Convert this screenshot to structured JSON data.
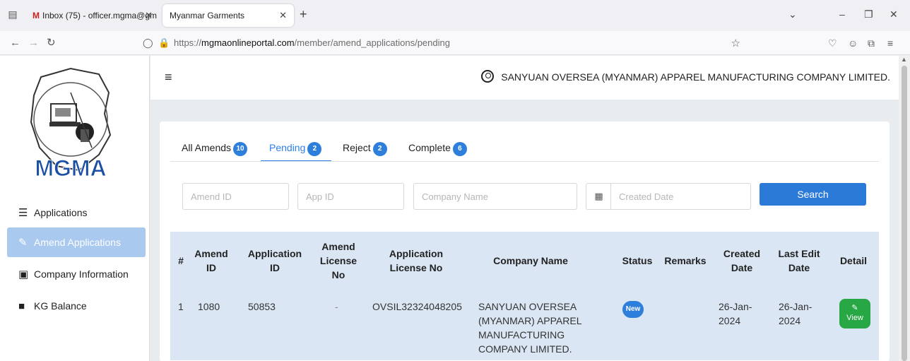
{
  "browser": {
    "tabs": [
      {
        "title": "Inbox (75) - officer.mgma@gm",
        "favicon": "M"
      },
      {
        "title": "Myanmar Garments"
      }
    ],
    "url_prefix": "https://",
    "url_domain": "mgmaonlineportal.com",
    "url_path": "/member/amend_applications/pending"
  },
  "sidebar": {
    "logo_text": "MGMA",
    "items": [
      {
        "label": "Applications",
        "icon": "list-icon"
      },
      {
        "label": "Amend Applications",
        "icon": "pencil-icon",
        "active": true
      },
      {
        "label": "Company Information",
        "icon": "copy-icon"
      },
      {
        "label": "KG Balance",
        "icon": "user-box-icon"
      }
    ]
  },
  "header": {
    "company": "SANYUAN OVERSEA (MYANMAR) APPAREL MANUFACTURING COMPANY LIMITED."
  },
  "tabs": [
    {
      "label": "All Amends",
      "count": "10"
    },
    {
      "label": "Pending",
      "count": "2",
      "active": true
    },
    {
      "label": "Reject",
      "count": "2"
    },
    {
      "label": "Complete",
      "count": "6"
    }
  ],
  "filters": {
    "amend_id_placeholder": "Amend ID",
    "app_id_placeholder": "App ID",
    "company_placeholder": "Company Name",
    "date_placeholder": "Created Date",
    "search_label": "Search"
  },
  "table": {
    "headers": [
      "#",
      "Amend ID",
      "Application ID",
      "Amend License No",
      "Application License No",
      "Company Name",
      "Status",
      "Remarks",
      "Created Date",
      "Last Edit Date",
      "Detail"
    ],
    "rows": [
      {
        "num": "1",
        "amend_id": "1080",
        "application_id": "50853",
        "amend_license": "-",
        "app_license": "OVSIL32324048205",
        "company": "SANYUAN OVERSEA (MYANMAR) APPAREL MANUFACTURING COMPANY LIMITED.",
        "status": "New",
        "remarks": "",
        "created": "26-Jan-2024",
        "last_edit": "26-Jan-2024",
        "detail": "View"
      }
    ]
  },
  "colors": {
    "accent": "#2b7ad8",
    "badge": "#2d7fdb",
    "view": "#28a745",
    "sidebar_active": "#a9c9ef",
    "table_bg": "#dbe6f4"
  }
}
